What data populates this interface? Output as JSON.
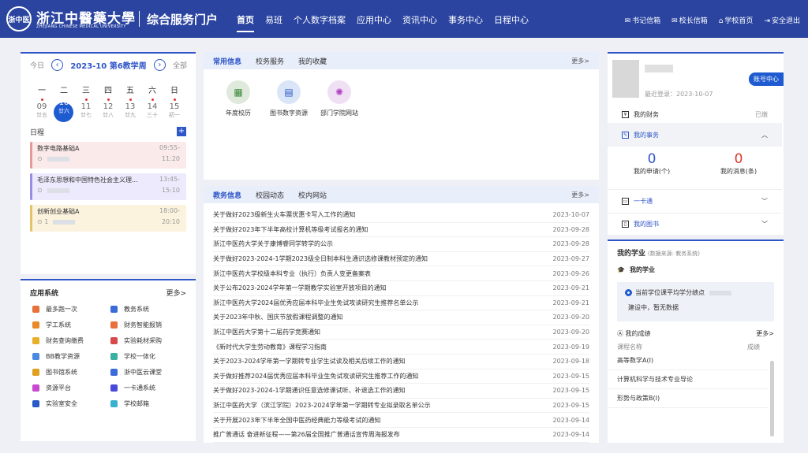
{
  "header": {
    "seal": "浙中医",
    "logo_cn": "浙江中醫藥大學",
    "logo_en": "ZHEJIANG CHINESE MEDICAL UNIVERSITY",
    "portal": "综合服务门户",
    "nav": [
      "首页",
      "易班",
      "个人数字档案",
      "应用中心",
      "资讯中心",
      "事务中心",
      "日程中心"
    ],
    "links": [
      "书记信箱",
      "校长信箱",
      "学校首页",
      "安全退出"
    ]
  },
  "calendar": {
    "today": "今日",
    "title": "2023-10 第6教学周",
    "all": "全部",
    "weekdays": [
      "一",
      "二",
      "三",
      "四",
      "五",
      "六",
      "日"
    ],
    "days": [
      {
        "n": "09",
        "l": "廿五"
      },
      {
        "n": "10",
        "l": "廿六"
      },
      {
        "n": "11",
        "l": "廿七"
      },
      {
        "n": "12",
        "l": "廿八"
      },
      {
        "n": "13",
        "l": "廿九"
      },
      {
        "n": "14",
        "l": "三十"
      },
      {
        "n": "15",
        "l": "初一"
      }
    ],
    "schedule_label": "日程",
    "events": [
      {
        "name": "数字电路基础A",
        "start": "09:55-",
        "end": "11:20"
      },
      {
        "name": "毛泽东思想和中国特色社会主义理...",
        "start": "13:45-",
        "end": "15:10"
      },
      {
        "name": "创新创业基础A",
        "start": "18:00-",
        "end": "20:10",
        "loc": "1"
      }
    ]
  },
  "apps": {
    "title": "应用系统",
    "more": "更多>",
    "items": [
      "最多跑一次",
      "教务系统",
      "学工系统",
      "财务智能报销",
      "财务查询缴费",
      "实验耗材采购",
      "BB教学资源",
      "学校一体化",
      "图书馆系统",
      "浙中医云课堂",
      "资源平台",
      "一卡通系统",
      "实验室安全",
      "学校邮箱"
    ]
  },
  "info": {
    "tabs": [
      "常用信息",
      "校务服务",
      "我的收藏"
    ],
    "more": "更多>",
    "shortcuts": [
      "年度校历",
      "图书数字资源",
      "部门学院网站"
    ]
  },
  "news": {
    "tabs": [
      "教务信息",
      "校园动态",
      "校内网站"
    ],
    "more": "更多>",
    "items": [
      {
        "t": "关于做好2023级新生火车票优惠卡写入工作的通知",
        "d": "2023-10-07"
      },
      {
        "t": "关于做好2023年下半年高校计算机等级考试报名的通知",
        "d": "2023-09-28"
      },
      {
        "t": "浙江中医药大学关于康博睿同学转学的公示",
        "d": "2023-09-28"
      },
      {
        "t": "关于做好2023-2024-1学期2023级全日制本科生通识选修课教材预定的通知",
        "d": "2023-09-27"
      },
      {
        "t": "浙江中医药大学校级本科专业（执行）负责人变更备案表",
        "d": "2023-09-26"
      },
      {
        "t": "关于公布2023-2024学年第一学期教学实验室开放项目的通知",
        "d": "2023-09-21"
      },
      {
        "t": "浙江中医药大学2024届优秀应届本科毕业生免试攻读研究生推荐名单公示",
        "d": "2023-09-21"
      },
      {
        "t": "关于2023年中秋、国庆节放假课程调整的通知",
        "d": "2023-09-20"
      },
      {
        "t": "浙江中医药大学第十二届药学竞赛通知",
        "d": "2023-09-20"
      },
      {
        "t": "《新时代大学生劳动教育》课程学习指南",
        "d": "2023-09-19"
      },
      {
        "t": "关于2023-2024学年第一学期转专业学生试读及相关后续工作的通知",
        "d": "2023-09-18"
      },
      {
        "t": "关于做好推荐2024届优秀应届本科毕业生免试攻读研究生推荐工作的通知",
        "d": "2023-09-15"
      },
      {
        "t": "关于做好2023-2024-1学期通识任意选修课试听、补退选工作的通知",
        "d": "2023-09-15"
      },
      {
        "t": "浙江中医药大学（滨江学院）2023-2024学年第一学期转专业拟录取名单公示",
        "d": "2023-09-15"
      },
      {
        "t": "关于开展2023年下半年全国中医药经典能力等级考试的通知",
        "d": "2023-09-14"
      },
      {
        "t": "推广普通话 奋进新征程——第26届全国推广普通话宣传周海报发布",
        "d": "2023-09-14"
      }
    ]
  },
  "user": {
    "last_login": "最近登录：2023-10-07",
    "account": "账号中心",
    "finance": "我的财务",
    "finance_status": "已缴",
    "affairs": "我的事务",
    "apply_count": "0",
    "apply_label": "我的申请(个)",
    "msg_count": "0",
    "msg_label": "我的消息(条)",
    "card": "一卡通",
    "library": "我的图书"
  },
  "study": {
    "title": "我的学业",
    "source": "(数据来源: 教务系统)",
    "sub": "我的学业",
    "credit": "当前学位课平均学分绩点",
    "building": "建设中，暂无数据",
    "scores": "我的成绩",
    "more": "更多>",
    "col1": "课程名称",
    "col2": "成绩",
    "courses": [
      "高等数学A(Ⅰ)",
      "计算机科学与技术专业导论",
      "形势与政策B(Ⅰ)"
    ]
  }
}
